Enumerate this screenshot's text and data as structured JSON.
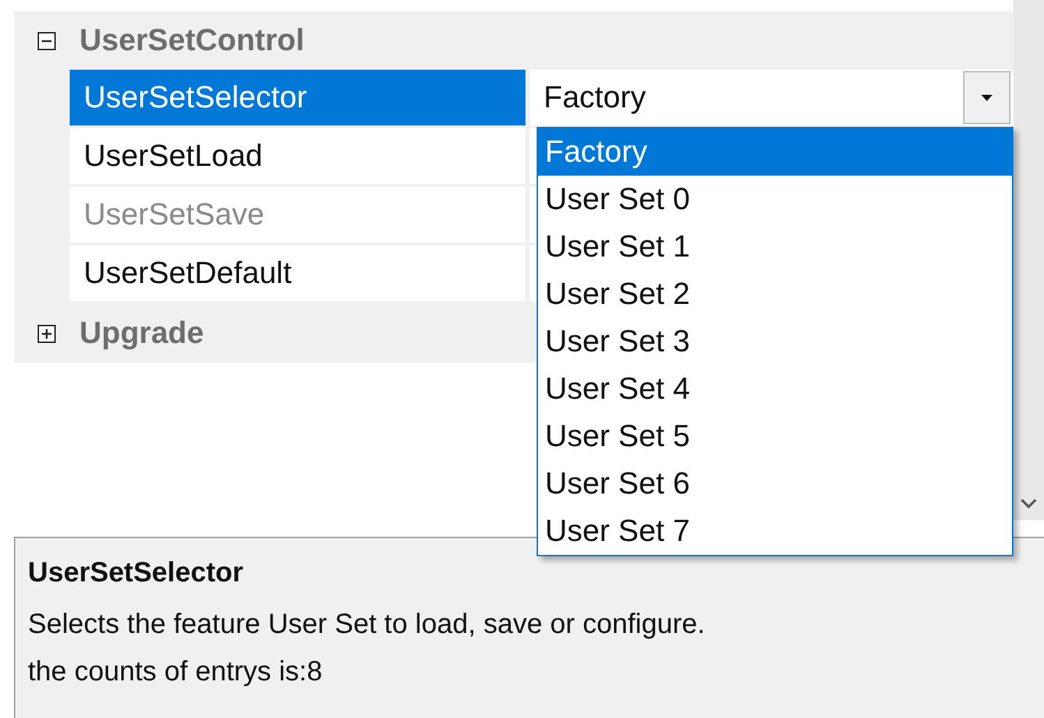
{
  "property_grid": {
    "categories": [
      {
        "name": "UserSetControl",
        "expanded": true,
        "properties": [
          {
            "name": "UserSetSelector",
            "selected": true,
            "disabled": false,
            "value": "Factory"
          },
          {
            "name": "UserSetLoad",
            "selected": false,
            "disabled": false
          },
          {
            "name": "UserSetSave",
            "selected": false,
            "disabled": true
          },
          {
            "name": "UserSetDefault",
            "selected": false,
            "disabled": false
          }
        ]
      },
      {
        "name": "Upgrade",
        "expanded": false
      }
    ]
  },
  "dropdown": {
    "options": [
      {
        "label": "Factory",
        "selected": true
      },
      {
        "label": "User Set 0",
        "selected": false
      },
      {
        "label": "User Set 1",
        "selected": false
      },
      {
        "label": "User Set 2",
        "selected": false
      },
      {
        "label": "User Set 3",
        "selected": false
      },
      {
        "label": "User Set 4",
        "selected": false
      },
      {
        "label": "User Set 5",
        "selected": false
      },
      {
        "label": "User Set 6",
        "selected": false
      },
      {
        "label": "User Set 7",
        "selected": false
      }
    ]
  },
  "description": {
    "title": "UserSetSelector",
    "lines": [
      "Selects the feature User Set to load, save or configure.",
      "the counts of entrys is:8"
    ]
  }
}
